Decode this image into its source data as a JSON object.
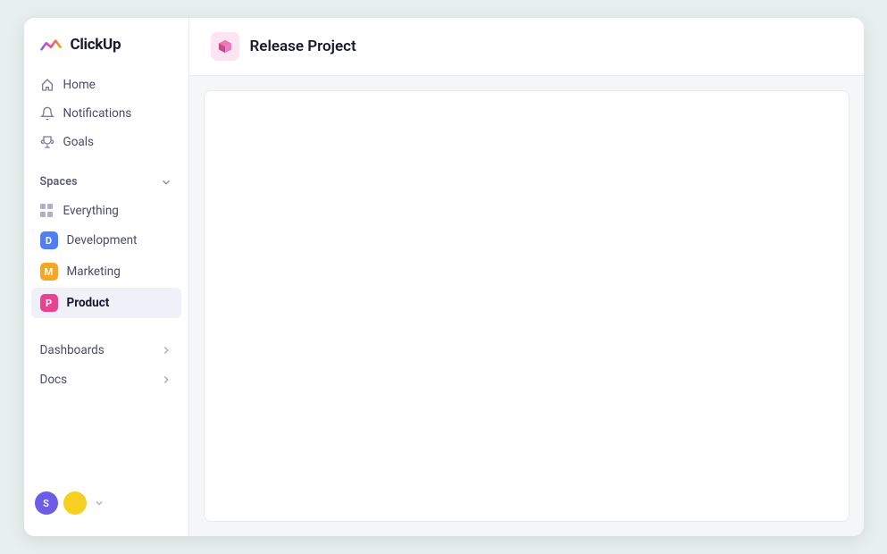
{
  "logo": {
    "text": "ClickUp"
  },
  "nav": {
    "items": [
      {
        "id": "home",
        "label": "Home",
        "icon": "home"
      },
      {
        "id": "notifications",
        "label": "Notifications",
        "icon": "bell"
      },
      {
        "id": "goals",
        "label": "Goals",
        "icon": "trophy"
      }
    ]
  },
  "spaces": {
    "label": "Spaces",
    "items": [
      {
        "id": "everything",
        "label": "Everything",
        "type": "dots"
      },
      {
        "id": "development",
        "label": "Development",
        "type": "badge",
        "badge": "D",
        "color": "blue"
      },
      {
        "id": "marketing",
        "label": "Marketing",
        "type": "badge",
        "badge": "M",
        "color": "yellow"
      },
      {
        "id": "product",
        "label": "Product",
        "type": "badge",
        "badge": "P",
        "color": "pink",
        "active": true
      }
    ]
  },
  "bottom_nav": {
    "items": [
      {
        "id": "dashboards",
        "label": "Dashboards"
      },
      {
        "id": "docs",
        "label": "Docs"
      }
    ]
  },
  "header": {
    "title": "Release Project"
  },
  "footer": {
    "avatar1": "S",
    "avatar2": ""
  }
}
